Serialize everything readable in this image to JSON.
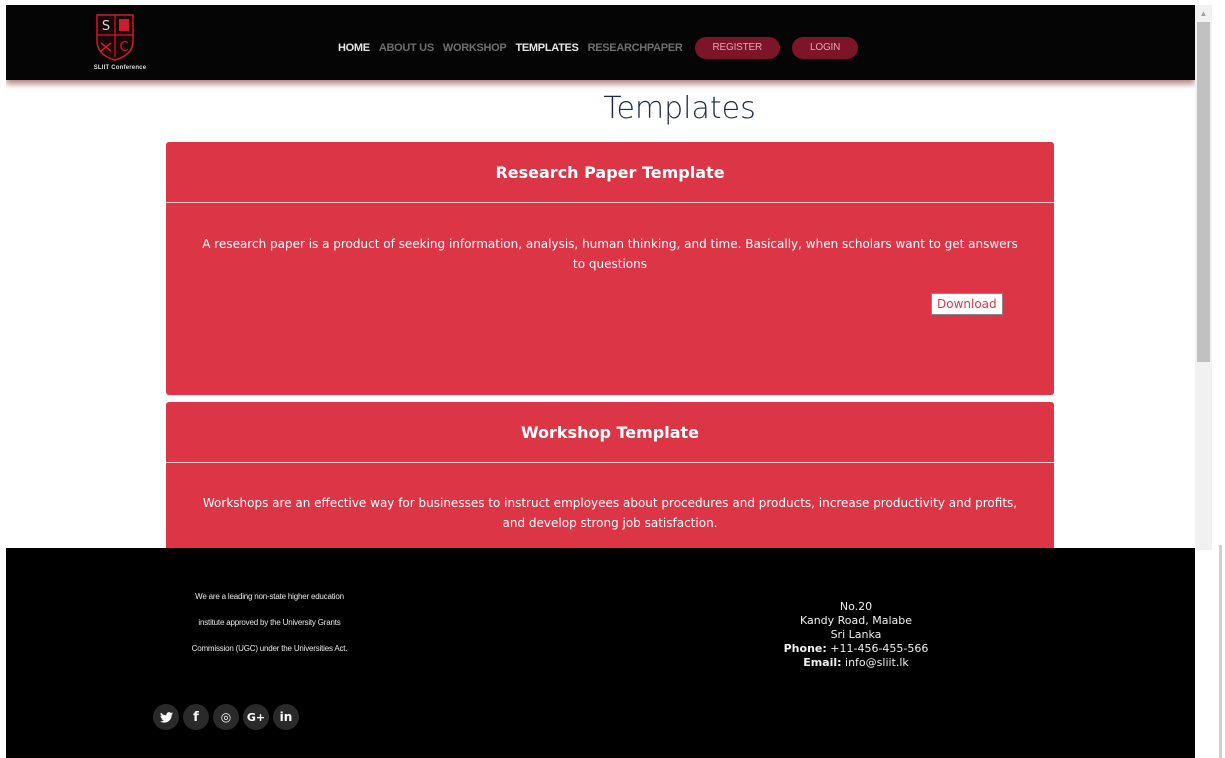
{
  "brand": {
    "logo_text": "SLIIT Conference",
    "logo_letters": [
      "S",
      "C"
    ]
  },
  "nav": {
    "links": [
      "HOME",
      "ABOUT US",
      "WORKSHOP",
      "TEMPLATES",
      "RESEARCHPAPER"
    ],
    "active": "TEMPLATES",
    "register_label": "REGISTER",
    "login_label": "LOGIN"
  },
  "page": {
    "title": "Templates"
  },
  "cards": [
    {
      "title": "Research Paper Template",
      "description": "A research paper is a product of seeking information, analysis, human thinking, and time. Basically, when scholars want to get answers to questions",
      "button_label": "Download"
    },
    {
      "title": "Workshop Template",
      "description": "Workshops are an effective way for businesses to instruct employees about procedures and products, increase productivity and profits, and develop strong job satisfaction."
    }
  ],
  "footer": {
    "about_lines": [
      "We are a leading non-state higher education",
      "institute approved by the University Grants",
      "Commission (UGC) under the Universities Act."
    ],
    "address_lines": [
      "No.20",
      "Kandy Road, Malabe",
      "Sri Lanka"
    ],
    "phone_label": "Phone:",
    "phone": " +11-456-455-566",
    "email_label": "Email:",
    "email": " info@sliit.lk",
    "socials": [
      {
        "icon": "twitter-icon",
        "glyph": "🐦"
      },
      {
        "icon": "facebook-icon",
        "glyph": "f"
      },
      {
        "icon": "instagram-icon",
        "glyph": "◎"
      },
      {
        "icon": "google-plus-icon",
        "glyph": "G+"
      },
      {
        "icon": "linkedin-icon",
        "glyph": "in"
      }
    ]
  },
  "colors": {
    "accent": "#dc3545",
    "nav_pill": "#7d1428",
    "navbar_bg": "#050505",
    "footer_bg": "#000000",
    "title": "#1f2a44"
  }
}
